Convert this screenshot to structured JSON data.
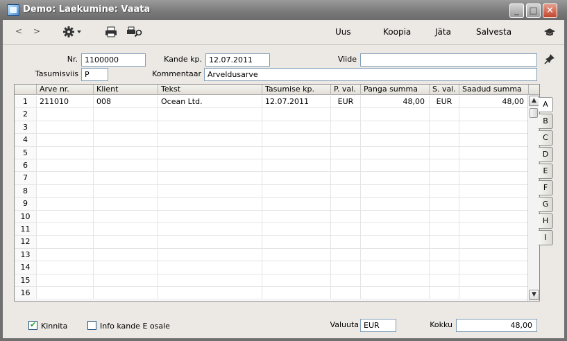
{
  "window": {
    "title": "Demo: Laekumine: Vaata"
  },
  "toolbar": {
    "nav_prev": "<",
    "nav_next": ">",
    "new_label": "Uus",
    "copy_label": "Koopia",
    "skip_label": "Jäta",
    "save_label": "Salvesta"
  },
  "header": {
    "nr_label": "Nr.",
    "nr_value": "1100000",
    "date_label": "Kande kp.",
    "date_value": "12.07.2011",
    "ref_label": "Viide",
    "ref_value": "",
    "method_label": "Tasumisviis",
    "method_value": "P",
    "comment_label": "Kommentaar",
    "comment_value": "Arveldusarve"
  },
  "table": {
    "columns": [
      "",
      "Arve nr.",
      "Klient",
      "Tekst",
      "Tasumise kp.",
      "P. val.",
      "Panga summa",
      "S. val.",
      "Saadud summa"
    ],
    "rows": [
      [
        "1",
        "211010",
        "008",
        "Ocean Ltd.",
        "12.07.2011",
        "EUR",
        "48,00",
        "EUR",
        "48,00"
      ],
      [
        "2",
        "",
        "",
        "",
        "",
        "",
        "",
        "",
        ""
      ],
      [
        "3",
        "",
        "",
        "",
        "",
        "",
        "",
        "",
        ""
      ],
      [
        "4",
        "",
        "",
        "",
        "",
        "",
        "",
        "",
        ""
      ],
      [
        "5",
        "",
        "",
        "",
        "",
        "",
        "",
        "",
        ""
      ],
      [
        "6",
        "",
        "",
        "",
        "",
        "",
        "",
        "",
        ""
      ],
      [
        "7",
        "",
        "",
        "",
        "",
        "",
        "",
        "",
        ""
      ],
      [
        "8",
        "",
        "",
        "",
        "",
        "",
        "",
        "",
        ""
      ],
      [
        "9",
        "",
        "",
        "",
        "",
        "",
        "",
        "",
        ""
      ],
      [
        "10",
        "",
        "",
        "",
        "",
        "",
        "",
        "",
        ""
      ],
      [
        "11",
        "",
        "",
        "",
        "",
        "",
        "",
        "",
        ""
      ],
      [
        "12",
        "",
        "",
        "",
        "",
        "",
        "",
        "",
        ""
      ],
      [
        "13",
        "",
        "",
        "",
        "",
        "",
        "",
        "",
        ""
      ],
      [
        "14",
        "",
        "",
        "",
        "",
        "",
        "",
        "",
        ""
      ],
      [
        "15",
        "",
        "",
        "",
        "",
        "",
        "",
        "",
        ""
      ],
      [
        "16",
        "",
        "",
        "",
        "",
        "",
        "",
        "",
        ""
      ]
    ]
  },
  "tabs": [
    "A",
    "B",
    "C",
    "D",
    "E",
    "F",
    "G",
    "H",
    "I"
  ],
  "footer": {
    "confirm_label": "Kinnita",
    "confirm_checked": true,
    "info_label": "Info kande E osale",
    "info_checked": false,
    "currency_label": "Valuuta",
    "currency_value": "EUR",
    "total_label": "Kokku",
    "total_value": "48,00"
  }
}
